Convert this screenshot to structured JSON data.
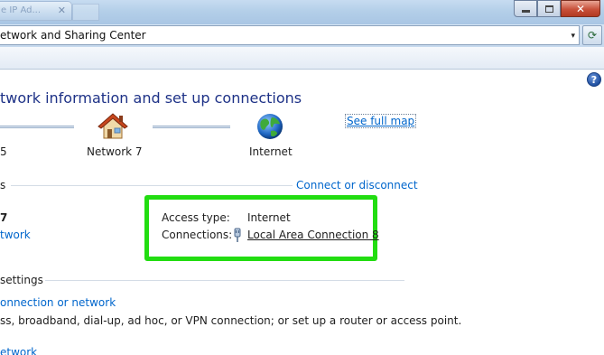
{
  "window": {
    "tab_ghost_text": "e IP Ad...",
    "controls": {
      "minimize": "minimize",
      "maximize": "maximize",
      "close": "✕"
    }
  },
  "address_bar": {
    "path": "etwork and Sharing Center",
    "dropdown_glyph": "▾",
    "refresh_glyph": "⟳"
  },
  "help": {
    "label": "?"
  },
  "content": {
    "title": "twork information and set up connections",
    "see_full_map": "See full map",
    "map": {
      "left_label": "5",
      "network_label": "Network  7",
      "internet_label": "Internet"
    },
    "active_networks": {
      "header_fragment": "s",
      "connect_disconnect": "Connect or disconnect",
      "network_name_fragment": "7",
      "network_link_fragment": "twork",
      "access_type_label": "Access type:",
      "access_type_value": "Internet",
      "connections_label": "Connections:",
      "connections_value": "Local Area Connection 8"
    },
    "change_settings": {
      "header_fragment": "settings",
      "setup_link_fragment": "onnection or network",
      "setup_desc_fragment": "ss, broadband, dial-up, ad hoc, or VPN connection; or set up a router or access point.",
      "next_link_fragment": "etwork"
    }
  },
  "colors": {
    "title_blue": "#1e3287",
    "link_blue": "#0066cc",
    "highlight_green": "#22dd11"
  },
  "icons": [
    "house-icon",
    "globe-icon",
    "plug-icon",
    "help-icon",
    "refresh-icon"
  ]
}
